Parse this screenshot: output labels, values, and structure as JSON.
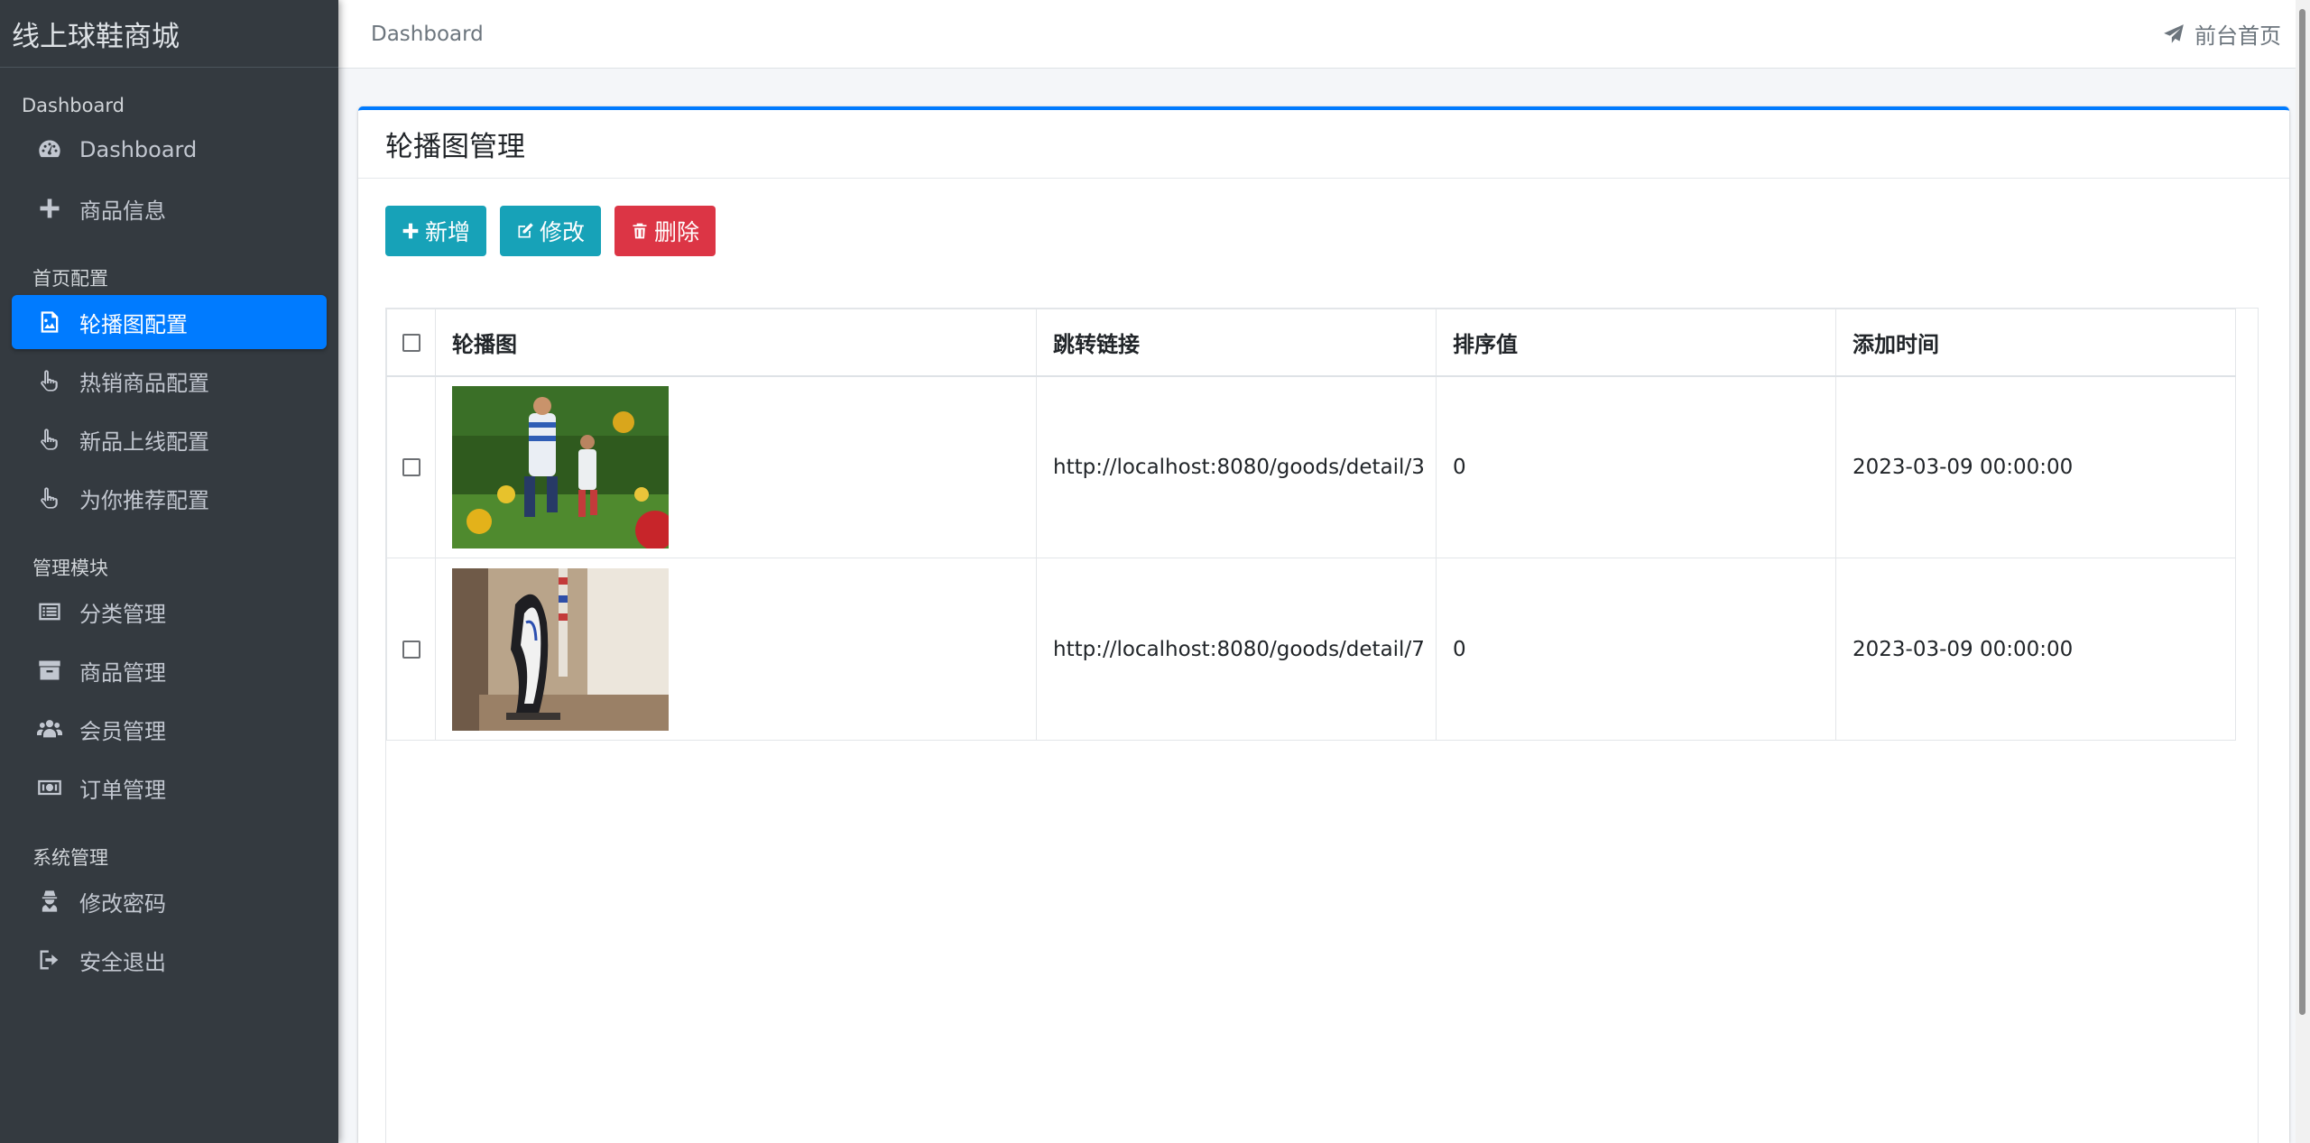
{
  "sidebar": {
    "brand": "线上球鞋商城",
    "sections": [
      {
        "header": "Dashboard",
        "items": [
          {
            "label": "Dashboard",
            "icon": "tachometer-icon"
          },
          {
            "label": "商品信息",
            "icon": "plus-icon"
          }
        ]
      },
      {
        "header": "首页配置",
        "items": [
          {
            "label": "轮播图配置",
            "icon": "image-icon",
            "active": true
          },
          {
            "label": "热销商品配置",
            "icon": "hand-pointer-icon"
          },
          {
            "label": "新品上线配置",
            "icon": "hand-pointer-icon"
          },
          {
            "label": "为你推荐配置",
            "icon": "hand-pointer-icon"
          }
        ]
      },
      {
        "header": "管理模块",
        "items": [
          {
            "label": "分类管理",
            "icon": "list-alt-icon"
          },
          {
            "label": "商品管理",
            "icon": "archive-icon"
          },
          {
            "label": "会员管理",
            "icon": "users-icon"
          },
          {
            "label": "订单管理",
            "icon": "money-bill-icon"
          }
        ]
      },
      {
        "header": "系统管理",
        "items": [
          {
            "label": "修改密码",
            "icon": "user-secret-icon"
          },
          {
            "label": "安全退出",
            "icon": "sign-out-icon"
          }
        ]
      }
    ]
  },
  "navbar": {
    "breadcrumb": "Dashboard",
    "front_link": "前台首页"
  },
  "card": {
    "title": "轮播图管理",
    "buttons": {
      "add": "新增",
      "edit": "修改",
      "delete": "删除"
    },
    "accent_color": "#007bff"
  },
  "table": {
    "columns": [
      "轮播图",
      "跳转链接",
      "排序值",
      "添加时间"
    ],
    "rows": [
      {
        "image": "kids-jumping-flowers-photo",
        "link": "http://localhost:8080/goods/detail/3",
        "order": "0",
        "added": "2023-03-09 00:00:00"
      },
      {
        "image": "sneaker-product-photo",
        "link": "http://localhost:8080/goods/detail/7",
        "order": "0",
        "added": "2023-03-09 00:00:00"
      }
    ]
  },
  "colors": {
    "sidebar_bg": "#343a40",
    "active": "#007bff",
    "info": "#17a2b8",
    "danger": "#dc3545"
  }
}
